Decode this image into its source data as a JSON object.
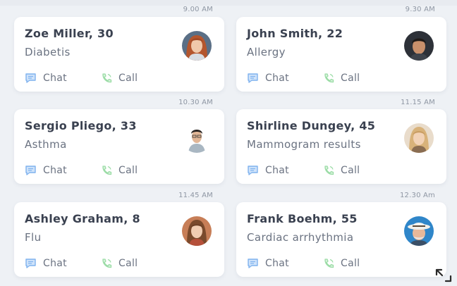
{
  "appointments": [
    {
      "time": "9.00 AM",
      "name": "Zoe Miller, 30",
      "condition": "Diabetis",
      "chat_label": "Chat",
      "call_label": "Call",
      "avatar": "woman-red-hair-avatar"
    },
    {
      "time": "9.30 AM",
      "name": "John Smith, 22",
      "condition": "Allergy",
      "chat_label": "Chat",
      "call_label": "Call",
      "avatar": "man-dark-hair-avatar"
    },
    {
      "time": "10.30 AM",
      "name": "Sergio Pliego, 33",
      "condition": "Asthma",
      "chat_label": "Chat",
      "call_label": "Call",
      "avatar": "man-glasses-avatar"
    },
    {
      "time": "11.15 AM",
      "name": "Shirline Dungey, 45",
      "condition": "Mammogram results",
      "chat_label": "Chat",
      "call_label": "Call",
      "avatar": "woman-blonde-avatar"
    },
    {
      "time": "11.45 AM",
      "name": "Ashley Graham, 8",
      "condition": "Flu",
      "chat_label": "Chat",
      "call_label": "Call",
      "avatar": "girl-brown-hair-avatar"
    },
    {
      "time": "12.30 Am",
      "name": "Frank Boehm, 55",
      "condition": "Cardiac arrhythmia",
      "chat_label": "Chat",
      "call_label": "Call",
      "avatar": "man-cowboy-hat-avatar"
    }
  ],
  "colors": {
    "background": "#eef1f5",
    "card": "#ffffff",
    "chat_icon": "#7fb2ee",
    "call_icon": "#9bdca6",
    "name_text": "#3a4150",
    "secondary_text": "#6a7281"
  },
  "icons": {
    "chat": "chat-bubble-icon",
    "call": "phone-icon",
    "expand": "expand-arrows-icon"
  }
}
